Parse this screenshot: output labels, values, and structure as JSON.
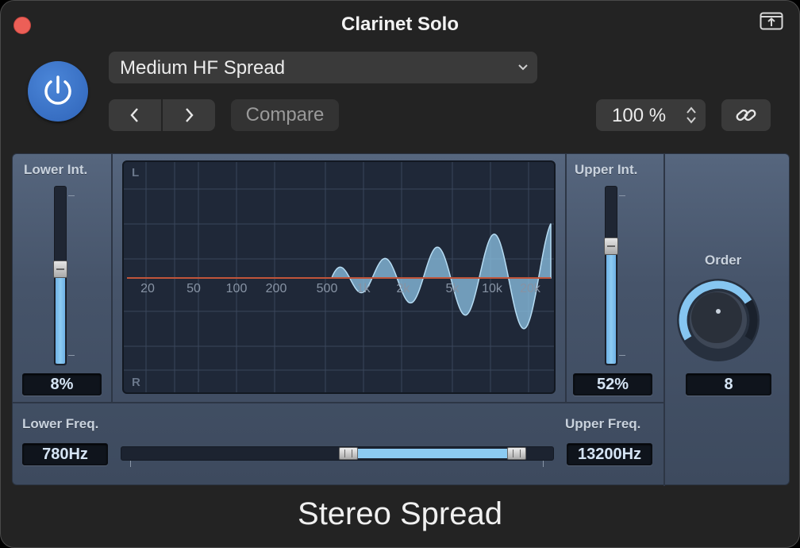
{
  "window": {
    "title": "Clarinet Solo"
  },
  "toolbar": {
    "preset": "Medium HF Spread",
    "compare_label": "Compare",
    "zoom": "100 %",
    "icons": [
      "power-icon",
      "chevron-down-icon",
      "chevron-left-icon",
      "chevron-right-icon",
      "stepper-icon",
      "link-icon",
      "expand-icon"
    ]
  },
  "plugin": {
    "lower_int": {
      "label": "Lower Int.",
      "value": "8%",
      "level": 0.55
    },
    "upper_int": {
      "label": "Upper Int.",
      "value": "52%",
      "level": 0.68
    },
    "lower_freq": {
      "label": "Lower Freq.",
      "value": "780Hz"
    },
    "upper_freq": {
      "label": "Upper Freq.",
      "value": "13200Hz"
    },
    "order": {
      "label": "Order",
      "value": "8"
    },
    "graph": {
      "channel_top": "L",
      "channel_bottom": "R",
      "freq_labels": [
        "20",
        "50",
        "100",
        "200",
        "500",
        "1k",
        "2k",
        "5k",
        "10k",
        "20k"
      ]
    },
    "colors": {
      "accent": "#8ccbf2",
      "zero_line": "#c0553a",
      "power": "#3a72c8"
    }
  },
  "footer": {
    "name": "Stereo Spread"
  }
}
